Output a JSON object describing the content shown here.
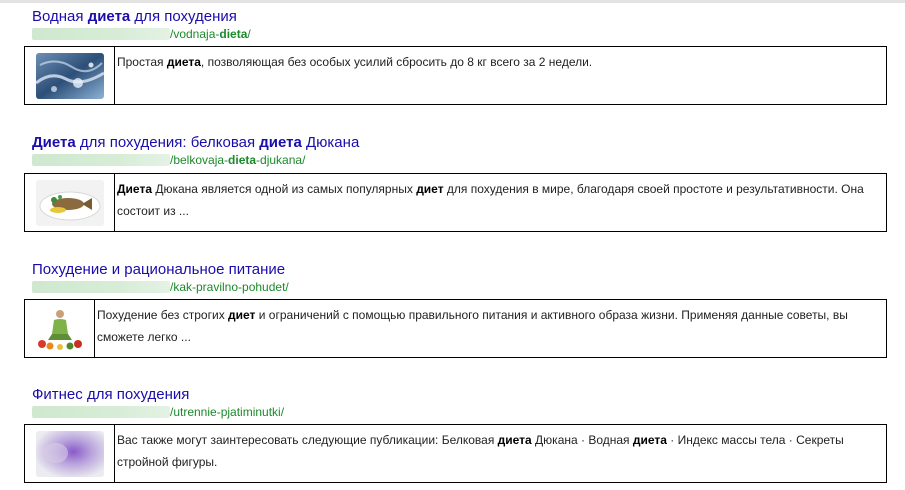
{
  "results": [
    {
      "title": [
        {
          "t": "Водная ",
          "b": false
        },
        {
          "t": "диета",
          "b": true
        },
        {
          "t": " для похудения",
          "b": false
        }
      ],
      "url": [
        {
          "t": "/vodnaja-",
          "b": false
        },
        {
          "t": "dieta",
          "b": true
        },
        {
          "t": "/",
          "b": false
        }
      ],
      "snippet": [
        {
          "t": "Простая ",
          "b": false
        },
        {
          "t": "диета",
          "b": true
        },
        {
          "t": ", позволяющая без особых усилий сбросить до 8 кг всего за 2 недели.",
          "b": false
        }
      ],
      "thumb_icon": "water-splash-icon"
    },
    {
      "title": [
        {
          "t": "Диета",
          "b": true
        },
        {
          "t": " для похудения: белковая ",
          "b": false
        },
        {
          "t": "диета",
          "b": true
        },
        {
          "t": " Дюкана",
          "b": false
        }
      ],
      "url": [
        {
          "t": "/belkovaja-",
          "b": false
        },
        {
          "t": "dieta",
          "b": true
        },
        {
          "t": "-djukana/",
          "b": false
        }
      ],
      "snippet": [
        {
          "t": "Диета",
          "b": true
        },
        {
          "t": " Дюкана является одной из самых популярных ",
          "b": false
        },
        {
          "t": "диет",
          "b": true
        },
        {
          "t": " для похудения в мире, благодаря своей простоте и результативности. Она состоит из ...",
          "b": false
        }
      ],
      "thumb_icon": "fish-plate-icon"
    },
    {
      "title": [
        {
          "t": "Похудение и рациональное питание",
          "b": false
        }
      ],
      "url": [
        {
          "t": "/kak-pravilno-pohudet/",
          "b": false
        }
      ],
      "snippet": [
        {
          "t": "Похудение без строгих ",
          "b": false
        },
        {
          "t": "диет",
          "b": true
        },
        {
          "t": " и ограничений с помощью правильного питания и активного образа жизни. Применяя данные советы, вы сможете легко ...",
          "b": false
        }
      ],
      "thumb_icon": "woman-vegetables-icon"
    },
    {
      "title": [
        {
          "t": "Фитнес для похудения",
          "b": false
        }
      ],
      "url": [
        {
          "t": "/utrennie-pjatiminutki/",
          "b": false
        }
      ],
      "snippet": [
        {
          "t": "Вас также могут заинтересовать следующие публикации: Белковая ",
          "b": false
        },
        {
          "t": "диета",
          "b": true
        },
        {
          "t": " Дюкана · Водная ",
          "b": false
        },
        {
          "t": "диета",
          "b": true
        },
        {
          "t": " · Индекс массы тела · Секреты стройной фигуры.",
          "b": false
        }
      ],
      "thumb_icon": "blurred-fitness-icon"
    }
  ]
}
